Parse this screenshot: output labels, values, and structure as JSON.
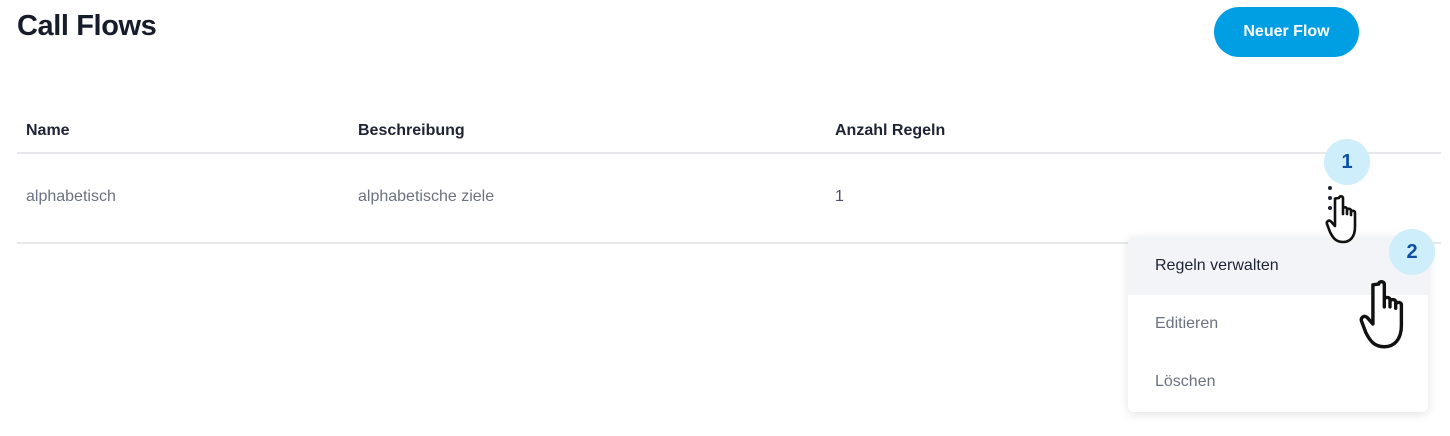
{
  "header": {
    "title": "Call Flows",
    "new_flow_label": "Neuer Flow"
  },
  "table": {
    "columns": [
      "Name",
      "Beschreibung",
      "Anzahl Regeln"
    ],
    "rows": [
      {
        "name": "alphabetisch",
        "description": "alphabetische ziele",
        "rule_count": "1"
      }
    ]
  },
  "context_menu": {
    "items": [
      {
        "label": "Regeln verwalten",
        "highlighted": true
      },
      {
        "label": "Editieren",
        "highlighted": false
      },
      {
        "label": "Löschen",
        "highlighted": false
      }
    ]
  },
  "tutorial": {
    "steps": [
      "1",
      "2"
    ],
    "pointer_icon": "hand-pointer-icon"
  },
  "colors": {
    "primary": "#009ee3",
    "badge_bg": "#cdeefa",
    "badge_text": "#0c4fa3",
    "text_dark": "#1e2433",
    "text_muted": "#6b7280",
    "divider": "#e6e8ec",
    "menu_highlight": "#f3f4f7"
  }
}
